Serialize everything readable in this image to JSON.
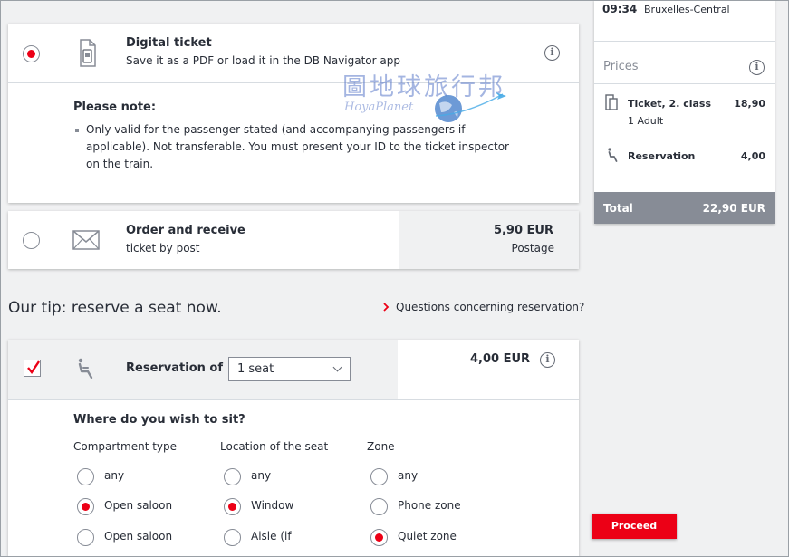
{
  "digital_ticket": {
    "title": "Digital ticket",
    "subtitle": "Save it as a PDF or load it in the DB Navigator app",
    "note_heading": "Please note:",
    "note_lines": [
      "Only valid for the passenger stated (and accompanying passengers if",
      "applicable). Not transferable. You must present your ID to the ticket inspector",
      "on the train."
    ],
    "selected": true
  },
  "watermark": {
    "chinese": "圖地球旅行邦",
    "english": "HoyaPlanet"
  },
  "post_ticket": {
    "title": "Order and receive",
    "subtitle": "ticket by post",
    "price": "5,90 EUR",
    "price_label": "Postage",
    "selected": false
  },
  "tip": {
    "heading": "Our tip: reserve a seat now.",
    "questions_link": "Questions concerning reservation?"
  },
  "reservation": {
    "label": "Reservation of",
    "select_value": "1 seat",
    "price": "4,00 EUR",
    "checked": true,
    "question": "Where do you wish to sit?",
    "columns": [
      {
        "heading": "Compartment type",
        "options": [
          "any",
          "Open saloon",
          "Open saloon"
        ],
        "selected_index": 1
      },
      {
        "heading": "Location of the seat",
        "options": [
          "any",
          "Window",
          "Aisle (if"
        ],
        "selected_index": 1
      },
      {
        "heading": "Zone",
        "options": [
          "any",
          "Phone zone",
          "Quiet zone"
        ],
        "selected_index": 2
      }
    ]
  },
  "sidebar": {
    "time": "09:34",
    "station": "Bruxelles-Central",
    "prices_heading": "Prices",
    "ticket_label": "Ticket, 2. class",
    "ticket_price": "18,90",
    "passengers": "1 Adult",
    "reservation_label": "Reservation",
    "reservation_price": "4,00",
    "total_label": "Total",
    "total_value": "22,90 EUR"
  },
  "proceed_label": "Proceed",
  "colors": {
    "accent": "#ec0016",
    "total_bg": "#878c96",
    "page_bg": "#f0f1f2"
  },
  "icons": [
    "info-icon",
    "phone-ticket-icon",
    "envelope-icon",
    "seat-icon",
    "chevron-right-icon",
    "chevron-down-icon",
    "globe-plane-icon"
  ]
}
